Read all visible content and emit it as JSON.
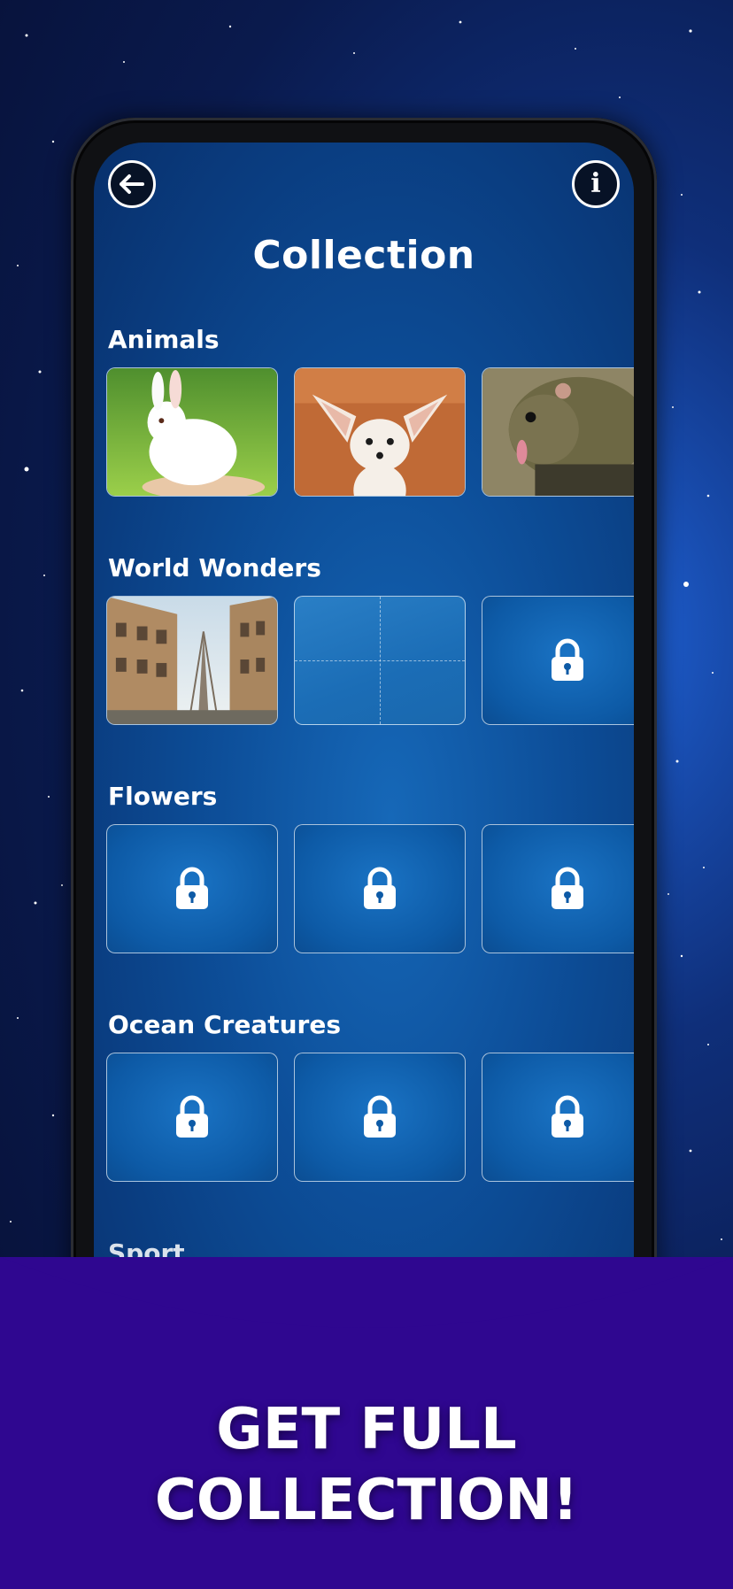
{
  "header": {
    "title": "Collection",
    "back_icon": "back-arrow-icon",
    "info_icon": "info-icon",
    "info_glyph": "i"
  },
  "sections": [
    {
      "label": "Animals",
      "cards": [
        {
          "state": "unlocked",
          "image": "white rabbit"
        },
        {
          "state": "unlocked",
          "image": "fennec fox"
        },
        {
          "state": "unlocked",
          "image": "treeshrew"
        }
      ]
    },
    {
      "label": "World Wonders",
      "cards": [
        {
          "state": "unlocked",
          "image": "eiffel tower street"
        },
        {
          "state": "in-progress"
        },
        {
          "state": "locked"
        }
      ]
    },
    {
      "label": "Flowers",
      "cards": [
        {
          "state": "locked"
        },
        {
          "state": "locked"
        },
        {
          "state": "locked"
        }
      ]
    },
    {
      "label": "Ocean Creatures",
      "cards": [
        {
          "state": "locked"
        },
        {
          "state": "locked"
        },
        {
          "state": "locked"
        }
      ]
    },
    {
      "label": "Sport",
      "cards": [
        {
          "state": "locked"
        },
        {
          "state": "locked"
        },
        {
          "state": "locked"
        }
      ]
    }
  ],
  "promo": {
    "line1": "GET FULL",
    "line2": "COLLECTION!"
  },
  "colors": {
    "banner": "#2f0790",
    "screen": "#0d4f9a",
    "space": "#0a1a4d"
  }
}
